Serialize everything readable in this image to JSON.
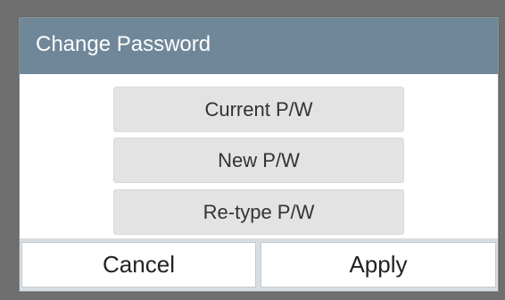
{
  "dialog": {
    "title": "Change Password",
    "fields": [
      {
        "label": "Current P/W"
      },
      {
        "label": "New P/W"
      },
      {
        "label": "Re-type P/W"
      }
    ],
    "buttons": {
      "cancel_label": "Cancel",
      "apply_label": "Apply"
    }
  },
  "colors": {
    "title_bar": "#6f8799",
    "field_bg": "#e3e3e3",
    "button_row_bg": "#d8dde2"
  }
}
